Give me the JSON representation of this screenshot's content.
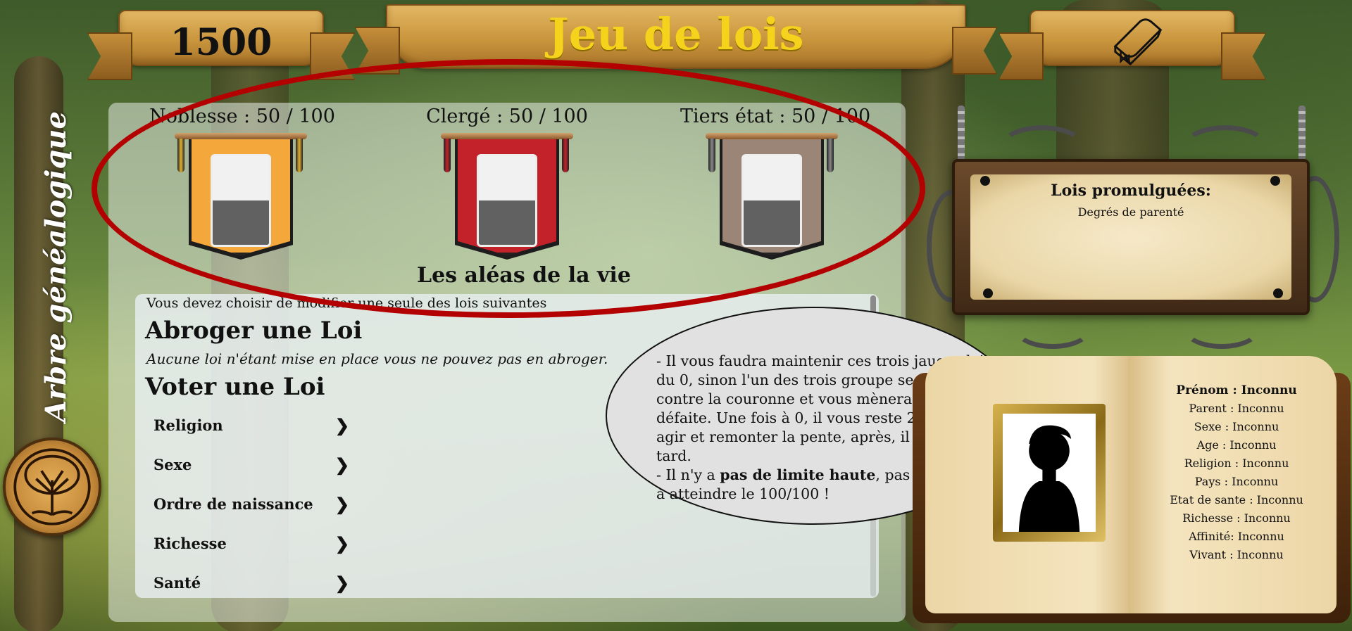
{
  "header": {
    "score": "1500",
    "title": "Jeu de lois",
    "book_icon": "book-icon"
  },
  "sidebar": {
    "family_tree_label": "Arbre généalogique",
    "tree_icon": "tree-of-life-icon"
  },
  "estates": [
    {
      "label": "Noblesse : 50 / 100",
      "value": 50,
      "max": 100,
      "color": "#f4a73a"
    },
    {
      "label": "Clergé : 50 / 100",
      "value": 50,
      "max": 100,
      "color": "#c4222a"
    },
    {
      "label": "Tiers état : 50 / 100",
      "value": 50,
      "max": 100,
      "color": "#9b8577"
    }
  ],
  "event": {
    "title": "Les aléas de la vie"
  },
  "laws": {
    "instruction": "Vous devez choisir de modifier une seule des lois suivantes",
    "repeal_title": "Abroger une Loi",
    "repeal_note": "Aucune loi n'étant mise en place vous ne pouvez pas en abroger.",
    "vote_title": "Voter une Loi",
    "items": [
      "Religion",
      "Sexe",
      "Ordre de naissance",
      "Richesse",
      "Santé"
    ],
    "chevron": "❯"
  },
  "tooltip": {
    "part1": "- Il vous faudra maintenir ces trois jauges loin du 0, sinon l'un des trois groupe se rebellera contre la couronne et vous mènera à la défaite. Une fois à 0, il vous reste 2 tour pour agir et remonter la pente, après, il sera trop tard.",
    "part2_prefix": "- Il n'y a ",
    "part2_bold": "pas de limite haute",
    "part2_suffix": ", pas de risque à atteindre le 100/100 !"
  },
  "promulgated": {
    "heading": "Lois promulguées:",
    "entries": [
      "Degrés de parenté"
    ]
  },
  "character": {
    "lines": [
      "Prénom : Inconnu",
      "Parent : Inconnu",
      "Sexe : Inconnu",
      "Age : Inconnu",
      "Religion : Inconnu",
      "Pays : Inconnu",
      "Etat de sante : Inconnu",
      "Richesse : Inconnu",
      "Affinité: Inconnu",
      "Vivant : Inconnu"
    ],
    "portrait_icon": "person-silhouette-icon"
  },
  "colors": {
    "title_gold": "#f5d21b",
    "annotation_red": "#b30000"
  }
}
